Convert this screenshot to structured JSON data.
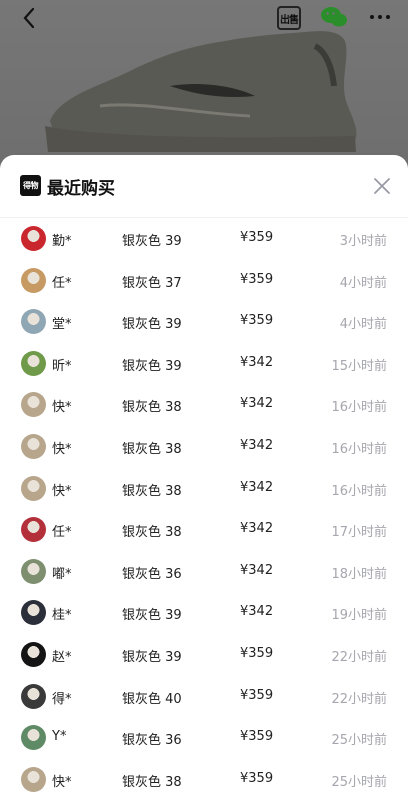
{
  "header": {
    "sell_label": "出售"
  },
  "sheet": {
    "brand_label": "得物",
    "title": "最近购买"
  },
  "purchases": [
    {
      "user": "勤*",
      "spec": "银灰色 39",
      "price": "¥359",
      "time": "3小时前",
      "avatar_color": "#c9262d"
    },
    {
      "user": "任*",
      "spec": "银灰色 37",
      "price": "¥359",
      "time": "4小时前",
      "avatar_color": "#c79a63"
    },
    {
      "user": "堂*",
      "spec": "银灰色 39",
      "price": "¥359",
      "time": "4小时前",
      "avatar_color": "#8fa7b5"
    },
    {
      "user": "昕*",
      "spec": "银灰色 39",
      "price": "¥342",
      "time": "15小时前",
      "avatar_color": "#6e9a4a"
    },
    {
      "user": "快*",
      "spec": "银灰色 38",
      "price": "¥342",
      "time": "16小时前",
      "avatar_color": "#b7a58c"
    },
    {
      "user": "快*",
      "spec": "银灰色 38",
      "price": "¥342",
      "time": "16小时前",
      "avatar_color": "#b7a58c"
    },
    {
      "user": "快*",
      "spec": "银灰色 38",
      "price": "¥342",
      "time": "16小时前",
      "avatar_color": "#b7a58c"
    },
    {
      "user": "任*",
      "spec": "银灰色 38",
      "price": "¥342",
      "time": "17小时前",
      "avatar_color": "#b3303a"
    },
    {
      "user": "嘟*",
      "spec": "银灰色 36",
      "price": "¥342",
      "time": "18小时前",
      "avatar_color": "#7e8f70"
    },
    {
      "user": "桂*",
      "spec": "银灰色 39",
      "price": "¥342",
      "time": "19小时前",
      "avatar_color": "#2b2f3a"
    },
    {
      "user": "赵*",
      "spec": "银灰色 39",
      "price": "¥359",
      "time": "22小时前",
      "avatar_color": "#141414"
    },
    {
      "user": "得*",
      "spec": "银灰色 40",
      "price": "¥359",
      "time": "22小时前",
      "avatar_color": "#3a3a3a"
    },
    {
      "user": "Y*",
      "spec": "银灰色 36",
      "price": "¥359",
      "time": "25小时前",
      "avatar_color": "#5f8a66"
    },
    {
      "user": "快*",
      "spec": "银灰色 38",
      "price": "¥359",
      "time": "25小时前",
      "avatar_color": "#b7a58c"
    }
  ]
}
